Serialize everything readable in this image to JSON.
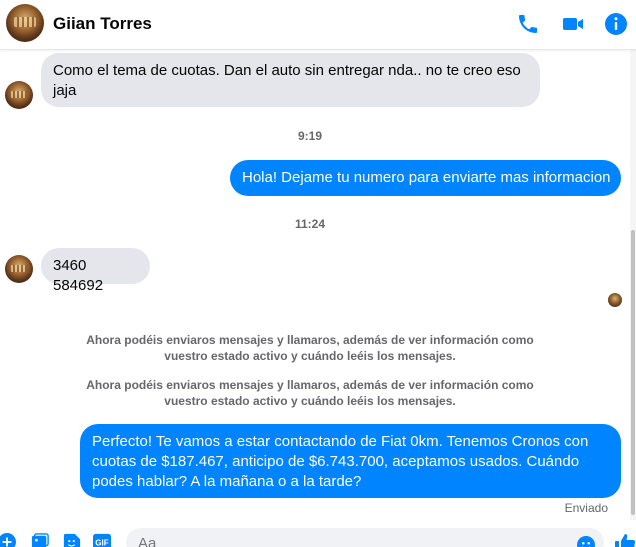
{
  "header": {
    "contact_name": "Giian Torres",
    "icons": [
      "phone-icon",
      "video-camera-icon",
      "info-icon"
    ],
    "accent_color": "#0084ff"
  },
  "messages": [
    {
      "direction": "incoming",
      "text_line1": "Como el tema de cuotas. Dan el auto sin entregar nda.. no te creo eso",
      "text_line2": "jaja"
    },
    {
      "type": "timestamp",
      "text": "9:19"
    },
    {
      "direction": "outgoing",
      "text": "Hola! Dejame tu numero para enviarte mas informacion"
    },
    {
      "type": "timestamp",
      "text": "11:24"
    },
    {
      "direction": "incoming",
      "text": "3460 584692"
    },
    {
      "type": "system",
      "line1": "Ahora podéis enviaros mensajes y llamaros, además de ver información como",
      "line2": "vuestro estado activo y cuándo leéis los mensajes."
    },
    {
      "type": "system",
      "line1": "Ahora podéis enviaros mensajes y llamaros, además de ver información como",
      "line2": "vuestro estado activo y cuándo leéis los mensajes."
    },
    {
      "direction": "outgoing",
      "line1": "Perfecto! Te vamos a estar contactando de Fiat 0km. Tenemos Cronos con",
      "line2": "cuotas de $187.467, anticipo de $6.743.700, aceptamos usados. Cuándo",
      "line3": "podes hablar? A la mañana o a la tarde?"
    }
  ],
  "status": "Enviado",
  "composer": {
    "placeholder": "Aa",
    "icons": [
      "plus-icon",
      "photo-icon",
      "sticker-icon",
      "gif-icon",
      "emoji-icon",
      "like-icon"
    ],
    "gif_label": "GIF"
  },
  "colors": {
    "incoming_bubble": "#e4e6eb",
    "outgoing_bubble": "#0084ff",
    "meta_text": "#65676b"
  }
}
